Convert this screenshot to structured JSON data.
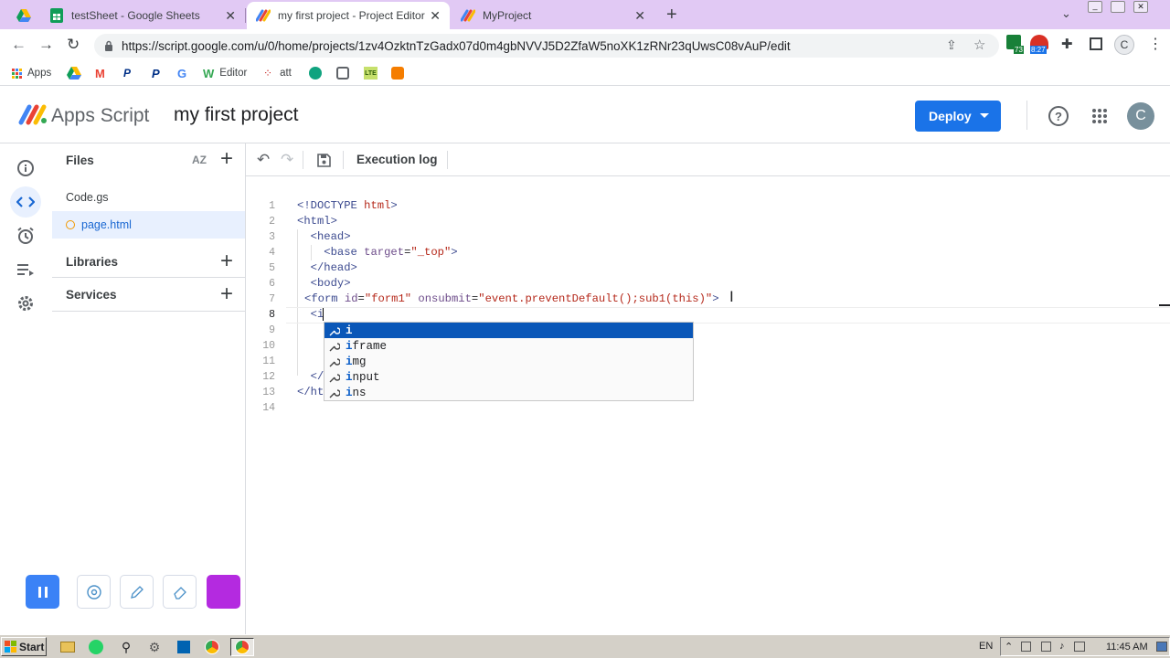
{
  "browser": {
    "tabs": [
      {
        "title": "testSheet - Google Sheets",
        "active": false
      },
      {
        "title": "my first project - Project Editor - Ap",
        "active": true
      },
      {
        "title": "MyProject",
        "active": false
      }
    ],
    "new_tab_label": "+",
    "url": "https://script.google.com/u/0/home/projects/1zv4OzktnTzGadx07d0m4gbNVVJ5D2ZfaW5noXK1zRNr23qUwsC08vAuP/edit",
    "extension_badges": {
      "sheets_count": "73",
      "timer": "8:27"
    },
    "profile_initial": "C",
    "bookmarks": [
      {
        "label": "Apps",
        "icon": "apps-grid-icon"
      },
      {
        "label": "",
        "icon": "drive-icon"
      },
      {
        "label": "",
        "icon": "gmail-icon"
      },
      {
        "label": "",
        "icon": "paypal-icon"
      },
      {
        "label": "",
        "icon": "paypal-icon"
      },
      {
        "label": "",
        "icon": "google-icon"
      },
      {
        "label": "Editor",
        "icon": "wix-icon"
      },
      {
        "label": "att",
        "icon": "att-icon"
      }
    ]
  },
  "app": {
    "product_name": "Apps Script",
    "project_title": "my first project",
    "deploy_label": "Deploy",
    "user_initial": "C",
    "accent": "#1a73e8"
  },
  "files_panel": {
    "files_header": "Files",
    "sort_label": "AZ",
    "files": [
      {
        "name": "Code.gs",
        "selected": false
      },
      {
        "name": "page.html",
        "selected": true
      }
    ],
    "libraries_label": "Libraries",
    "services_label": "Services"
  },
  "toolbar": {
    "execution_log_label": "Execution log"
  },
  "editor": {
    "line_numbers": [
      "1",
      "2",
      "3",
      "4",
      "5",
      "6",
      "7",
      "8",
      "9",
      "10",
      "11",
      "12",
      "13",
      "14"
    ],
    "autocomplete": [
      {
        "typed": "i",
        "rest": ""
      },
      {
        "typed": "i",
        "rest": "frame"
      },
      {
        "typed": "i",
        "rest": "mg"
      },
      {
        "typed": "i",
        "rest": "nput"
      },
      {
        "typed": "i",
        "rest": "ns"
      }
    ]
  },
  "taskbar": {
    "start_label": "Start",
    "language": "EN",
    "clock": "11:45 AM"
  }
}
